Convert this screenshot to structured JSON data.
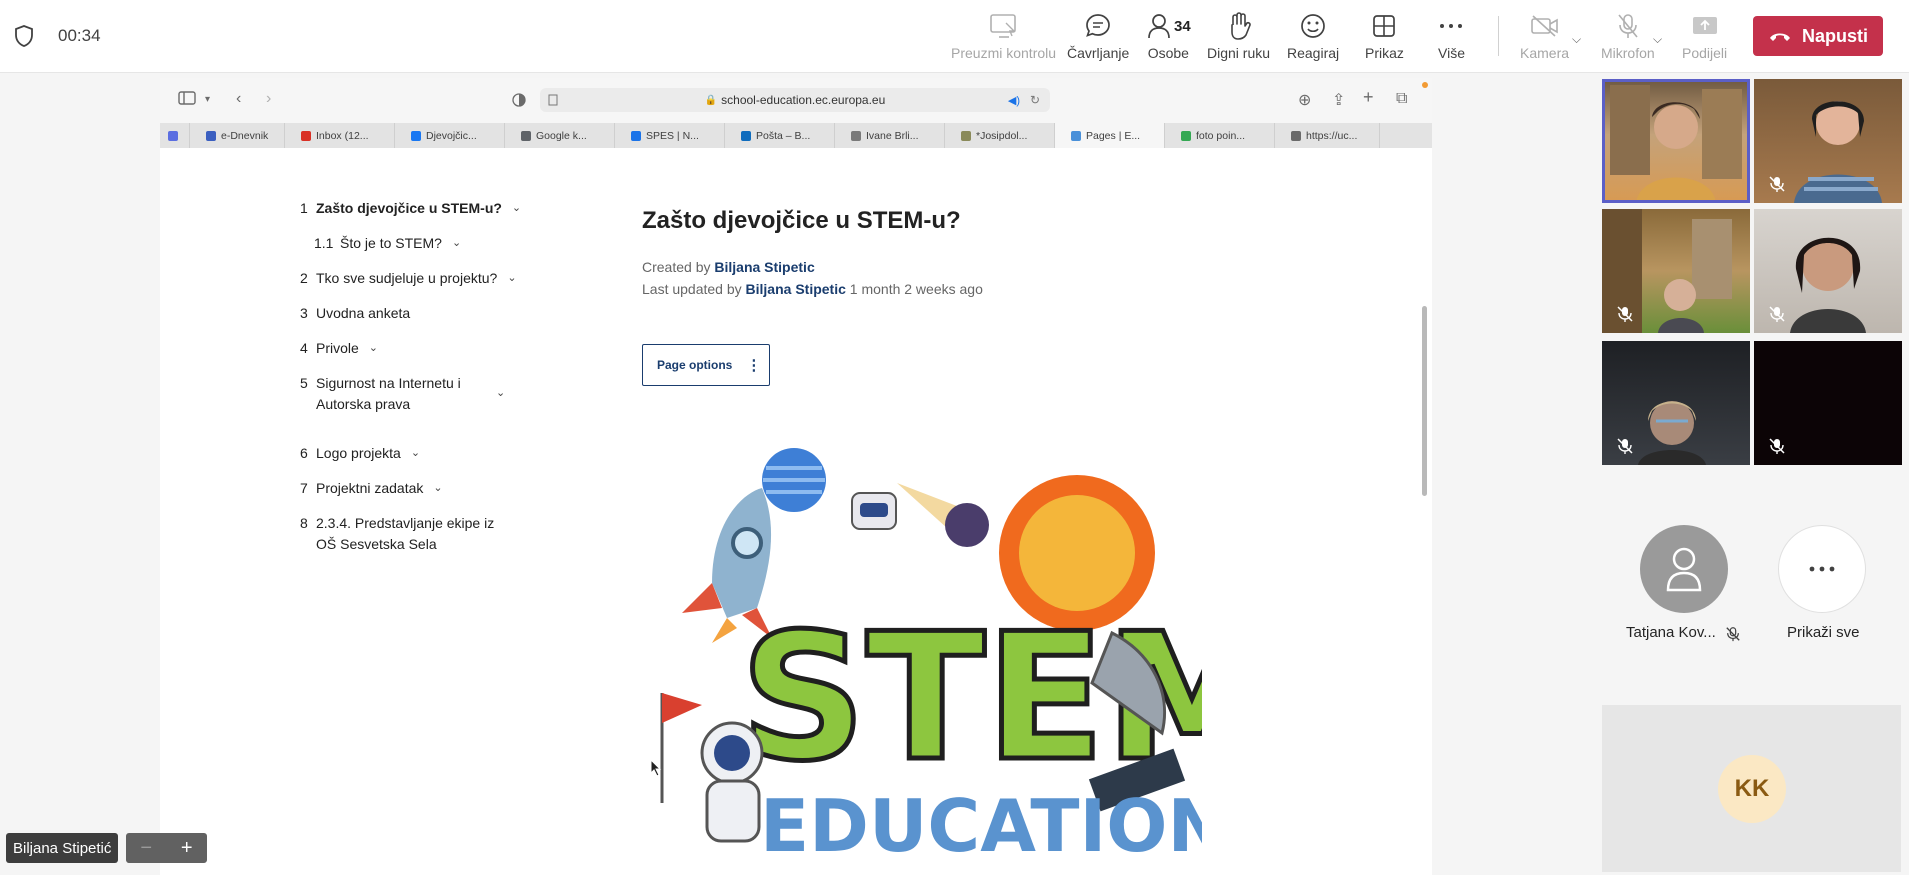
{
  "meeting": {
    "timer": "00:34",
    "toolbar": {
      "control": "Preuzmi kontrolu",
      "chat": "Čavrljanje",
      "people": "Osobe",
      "people_count": "34",
      "raise": "Digni ruku",
      "react": "Reagiraj",
      "view": "Prikaz",
      "more": "Više",
      "camera": "Kamera",
      "mic": "Mikrofon",
      "share": "Podijeli",
      "leave": "Napusti"
    }
  },
  "browser": {
    "url": "school-education.ec.europa.eu",
    "tabs": [
      {
        "label": "e-Dnevnik",
        "color": "#3b5fc0"
      },
      {
        "label": "Inbox (12...",
        "color": "#d93025"
      },
      {
        "label": "Djevojčic...",
        "color": "#1877f2"
      },
      {
        "label": "Google k...",
        "color": "#5f6368"
      },
      {
        "label": "SPES | N...",
        "color": "#1a73e8"
      },
      {
        "label": "Pošta – B...",
        "color": "#0f6cbd"
      },
      {
        "label": "Ivane Brli...",
        "color": "#7a7a7a"
      },
      {
        "label": "*Josipdol...",
        "color": "#8a8a5a"
      },
      {
        "label": "Pages | E...",
        "color": "#4a90d9"
      },
      {
        "label": "foto poin...",
        "color": "#34a853"
      },
      {
        "label": "https://uc...",
        "color": "#6a6a6a"
      }
    ]
  },
  "toc": [
    {
      "num": "1",
      "label": "Zašto djevojčice u STEM-u?",
      "bold": true
    },
    {
      "num": "1.1",
      "label": "Što je to STEM?"
    },
    {
      "num": "2",
      "label": "Tko sve sudjeluje u projektu?"
    },
    {
      "num": "3",
      "label": "Uvodna anketa"
    },
    {
      "num": "4",
      "label": "Privole"
    },
    {
      "num": "5",
      "label_line1": "Sigurnost na Internetu i",
      "label_line2": "Autorska prava"
    },
    {
      "num": "6",
      "label": "Logo projekta"
    },
    {
      "num": "7",
      "label": "Projektni zadatak"
    },
    {
      "num": "8",
      "label_line1": "2.3.4. Predstavljanje ekipe iz",
      "label_line2": "OŠ Sesvetska Sela"
    }
  ],
  "page": {
    "title": "Zašto djevojčice u STEM-u?",
    "created_prefix": "Created by",
    "created_by": "Biljana Stipetic",
    "updated_prefix": "Last updated by",
    "updated_by": "Biljana Stipetic",
    "updated_when": "1 month 2 weeks ago",
    "options": "Page options",
    "image_text": {
      "stem": "STEM",
      "education": "EDUCATION"
    }
  },
  "presenter": {
    "name": "Biljana Stipetić",
    "zoom_out": "−",
    "zoom_in": "+"
  },
  "participants": {
    "tatjana": "Tatjana Kov...",
    "show_all": "Prikaži sve",
    "kk": "KK"
  },
  "colors": {
    "leave": "#c4314b",
    "accent": "#5b5fc7",
    "link": "#1a3d6e"
  }
}
